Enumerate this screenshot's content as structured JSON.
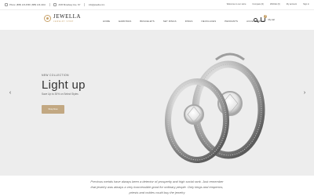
{
  "topbar": {
    "phone": "Phone: (888) 123-4568, (888) 123-4444",
    "address": "2345 Broadway Ave, NY",
    "email": "info@jewella.com",
    "welcome": "Welcome to our store",
    "compare": "Compare (0)",
    "wishlist": "Wishlist (0)",
    "account": "My account",
    "signin": "Sign in"
  },
  "header": {
    "logo_text": "JEWELLA",
    "logo_sub": "JEWELRY SHOP",
    "nav": [
      "HOME",
      "EARRINGS",
      "BRACELETS",
      "SET RINGS",
      "RINGS",
      "NECKLACES",
      "PENDANTS",
      "ACCESSORIES"
    ],
    "cart_count": "0",
    "cart_label": "My cart"
  },
  "hero": {
    "eyebrow": "NEW COLLECTION",
    "title": "Light up",
    "subtitle": "Save Up to 30% on Select Styles",
    "button": "Shop Now",
    "prev": "‹",
    "next": "›"
  },
  "intro": {
    "line1": "Precious metals have always been a detector of prosperity and high social rank. Just remember",
    "line2": "that jewelry was always a very inaccessible good for ordinary people. Only kings and emperors,",
    "line3": "priests and nobles could buy the jewelry"
  },
  "colors": {
    "accent": "#c2a882",
    "hero_bg": "#ededed"
  }
}
